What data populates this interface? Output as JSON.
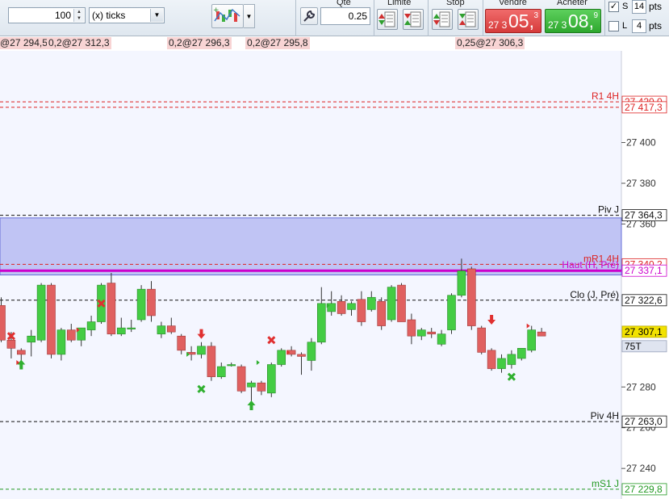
{
  "toolbar": {
    "quantity": "100",
    "unit": "(x) ticks",
    "qte_label": "Qte",
    "qte_value": "0.25",
    "limit_label": "Limite",
    "stop_label": "Stop",
    "sell_label": "Vendre",
    "buy_label": "Acheter",
    "sell_price": {
      "small": "27 3",
      "big": "05,",
      "sup": "3"
    },
    "buy_price": {
      "small": "27 3",
      "big": "08,",
      "sup": "9"
    },
    "s_label": "S",
    "s_checked": "✓",
    "s_pts": "14",
    "l_label": "L",
    "l_pts": "4",
    "pts_label": "pts"
  },
  "orders": [
    {
      "text": "@27 294,5"
    },
    {
      "text": "0,2@27 312,3"
    },
    {
      "text": "0,2@27 296,3"
    },
    {
      "text": "0,2@27 295,8"
    },
    {
      "text": "0,25@27 306,3"
    }
  ],
  "colors": {
    "bull": "#44cc44",
    "bear": "#e06060",
    "zone": "#c0c4f4",
    "magenta": "#cc00cc",
    "red_line": "#dd2222",
    "green_line": "#229922"
  },
  "chart_data": {
    "type": "candlestick",
    "ylim": [
      27225,
      27445
    ],
    "y_ticks": [
      "27 400",
      "27 380",
      "27 360",
      "27 280",
      "27 260",
      "27 240"
    ],
    "zone": {
      "low": 27335,
      "high": 27363
    },
    "levels": [
      {
        "label": "R1 4H",
        "value": 27420.0,
        "text": "27 420,0",
        "style": "red"
      },
      {
        "label": "",
        "value": 27417.3,
        "text": "27 417,3",
        "style": "red"
      },
      {
        "label": "Piv J",
        "value": 27364.3,
        "text": "27 364,3",
        "style": "black"
      },
      {
        "label": "mR1 4H",
        "value": 27340.2,
        "text": "27 340,2",
        "style": "red"
      },
      {
        "label": "Haut (H, Pré)",
        "value": 27337.1,
        "text": "27 337,1",
        "style": "magenta"
      },
      {
        "label": "Clo (J, Pré)",
        "value": 27322.6,
        "text": "27 322,6",
        "style": "black"
      },
      {
        "label": "",
        "value": 27307.1,
        "text": "27 307,1",
        "style": "current"
      },
      {
        "label": "",
        "value": 27300.0,
        "text": "75T",
        "style": "tag"
      },
      {
        "label": "Piv 4H",
        "value": 27263.0,
        "text": "27 263,0",
        "style": "black"
      },
      {
        "label": "mS1 J",
        "value": 27229.8,
        "text": "27 229,8",
        "style": "green"
      }
    ],
    "candles": [
      [
        27320,
        27324,
        27302,
        27303
      ],
      [
        27303,
        27307,
        27294,
        27299
      ],
      [
        27298,
        27299,
        27293,
        27296
      ],
      [
        27302,
        27308,
        27295,
        27305
      ],
      [
        27303,
        27331,
        27302,
        27330
      ],
      [
        27330,
        27331,
        27294,
        27296
      ],
      [
        27296,
        27309,
        27293,
        27308
      ],
      [
        27308,
        27311,
        27302,
        27303
      ],
      [
        27303,
        27309,
        27300,
        27309
      ],
      [
        27308,
        27315,
        27305,
        27312
      ],
      [
        27312,
        27331,
        27311,
        27330
      ],
      [
        27331,
        27336,
        27305,
        27306
      ],
      [
        27306,
        27314,
        27305,
        27309
      ],
      [
        27309,
        27313,
        27307,
        27309
      ],
      [
        27313,
        27330,
        27312,
        27328
      ],
      [
        27328,
        27332,
        27312,
        27315
      ],
      [
        27306,
        27312,
        27304,
        27310
      ],
      [
        27310,
        27314,
        27306,
        27307
      ],
      [
        27305,
        27306,
        27296,
        27298
      ],
      [
        27297,
        27300,
        27293,
        27296
      ],
      [
        27296,
        27302,
        27294,
        27300
      ],
      [
        27300,
        27302,
        27283,
        27285
      ],
      [
        27285,
        27292,
        27284,
        27290
      ],
      [
        27291,
        27292,
        27290,
        27291
      ],
      [
        27290,
        27291,
        27277,
        27278
      ],
      [
        27280,
        27283,
        27273,
        27282
      ],
      [
        27282,
        27283,
        27276,
        27278
      ],
      [
        27277,
        27292,
        27275,
        27291
      ],
      [
        27291,
        27299,
        27290,
        27298
      ],
      [
        27298,
        27300,
        27295,
        27296
      ],
      [
        27296,
        27297,
        27286,
        27295
      ],
      [
        27293,
        27304,
        27288,
        27302
      ],
      [
        27302,
        27329,
        27301,
        27321
      ],
      [
        27317,
        27327,
        27315,
        27321
      ],
      [
        27322,
        27325,
        27315,
        27316
      ],
      [
        27318,
        27322,
        27315,
        27321
      ],
      [
        27323,
        27327,
        27310,
        27312
      ],
      [
        27318,
        27327,
        27317,
        27324
      ],
      [
        27322,
        27324,
        27308,
        27310
      ],
      [
        27313,
        27330,
        27312,
        27329
      ],
      [
        27330,
        27331,
        27312,
        27312
      ],
      [
        27313,
        27316,
        27301,
        27305
      ],
      [
        27305,
        27309,
        27303,
        27308
      ],
      [
        27307,
        27309,
        27304,
        27306
      ],
      [
        27301,
        27308,
        27300,
        27306
      ],
      [
        27308,
        27326,
        27306,
        27325
      ],
      [
        27325,
        27343,
        27324,
        27337
      ],
      [
        27338,
        27339,
        27308,
        27310
      ],
      [
        27309,
        27310,
        27296,
        27297
      ],
      [
        27298,
        27299,
        27288,
        27289
      ],
      [
        27289,
        27296,
        27287,
        27294
      ],
      [
        27291,
        27298,
        27289,
        27296
      ],
      [
        27294,
        27299,
        27293,
        27299
      ],
      [
        27298,
        27310,
        27297,
        27308
      ],
      [
        27307,
        27309,
        27305,
        27305
      ]
    ],
    "markers": [
      {
        "i": 1,
        "y": 27305,
        "shape": "x",
        "color": "red"
      },
      {
        "i": 2,
        "y": 27291,
        "shape": "arrow-up",
        "color": "green"
      },
      {
        "i": 10,
        "y": 27321,
        "shape": "x",
        "color": "red"
      },
      {
        "i": 20,
        "y": 27306,
        "shape": "arrow-down",
        "color": "red"
      },
      {
        "i": 20,
        "y": 27279,
        "shape": "x",
        "color": "green"
      },
      {
        "i": 25,
        "y": 27271,
        "shape": "arrow-up",
        "color": "green"
      },
      {
        "i": 27,
        "y": 27303,
        "shape": "x",
        "color": "red"
      },
      {
        "i": 49,
        "y": 27313,
        "shape": "arrow-down",
        "color": "red"
      },
      {
        "i": 51,
        "y": 27285,
        "shape": "x",
        "color": "green"
      }
    ],
    "small_triangles": [
      {
        "i": 2,
        "y": 27292,
        "color": "red"
      },
      {
        "i": 8,
        "y": 27308,
        "color": "red"
      },
      {
        "i": 19,
        "y": 27296,
        "color": "green"
      },
      {
        "i": 26,
        "y": 27292,
        "color": "green"
      },
      {
        "i": 29,
        "y": 27297,
        "color": "red"
      },
      {
        "i": 33,
        "y": 27320,
        "color": "green"
      },
      {
        "i": 53,
        "y": 27310,
        "color": "red"
      }
    ]
  }
}
